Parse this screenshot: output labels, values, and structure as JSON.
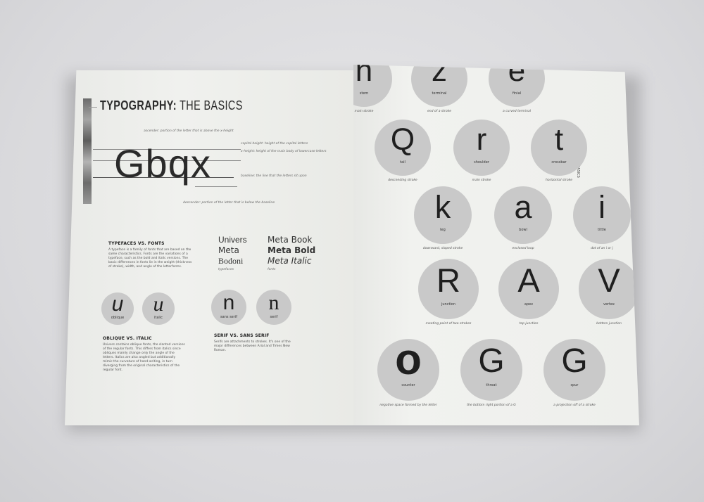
{
  "left_page": {
    "title_part1": "TYPOGRAPHY:",
    "title_part2": "THE BASICS",
    "specimen": "Gbqx",
    "notes": {
      "ascender": "ascender: portion of the letter that is above the x-height",
      "cap_height": "capital height: height of the capital letters",
      "x_height": "x-height: height of the main body of lowercase letters",
      "baseline": "baseline: the line that the letters sit upon",
      "descender": "descender: portion of the letter that is below the baseline"
    },
    "typefaces": {
      "heading": "TYPEFACES VS. FONTS",
      "body": "A typeface is a family of fonts that are based on the same characteristics. Fonts are the variations of a typeface, such as the bold and italic versions. The basic differences in fonts lie in the weight (thickness of stroke), width, and angle of the letterforms.",
      "typeface_list": [
        "Univers",
        "Meta",
        "Bodoni"
      ],
      "typefaces_caption": "typefaces",
      "font_list": [
        "Meta Book",
        "Meta Bold",
        "Meta Italic"
      ],
      "fonts_caption": "fonts"
    },
    "oblique": {
      "heading": "OBLIQUE VS. ITALIC",
      "body": "Univers contains oblique fonts, the slanted versions of the regular fonts. This differs from italics since obliques mainly change only the angle of the letters. Italics are also angled but additionally mimic the curvature of hand-writing, in turn diverging from the original characteristics of the regular font.",
      "circles": [
        {
          "glyph": "u",
          "label": "oblique"
        },
        {
          "glyph": "u",
          "label": "italic"
        }
      ]
    },
    "serif": {
      "heading": "SERIF VS. SANS SERIF",
      "body": "Serifs are attachments to strokes. It's one of the major differences between Arial and Times New Roman.",
      "circles": [
        {
          "glyph": "n",
          "label": "sans serif"
        },
        {
          "glyph": "n",
          "label": "serif"
        }
      ]
    }
  },
  "right_page": {
    "side_text": "TYPOGRAPHY: THE BASICS",
    "anatomy": [
      {
        "glyph": "n",
        "label": "stem",
        "caption": "main stroke"
      },
      {
        "glyph": "z",
        "label": "terminal",
        "caption": "end of a stroke"
      },
      {
        "glyph": "e",
        "label": "finial",
        "caption": "a curved terminal"
      },
      {
        "glyph": "Q",
        "label": "tail",
        "caption": "descending stroke"
      },
      {
        "glyph": "r",
        "label": "shoulder",
        "caption": "main stroke"
      },
      {
        "glyph": "t",
        "label": "crossbar",
        "caption": "horizontal stroke"
      },
      {
        "glyph": "k",
        "label": "leg",
        "caption": "downward, sloped stroke"
      },
      {
        "glyph": "a",
        "label": "bowl",
        "caption": "enclosed loop"
      },
      {
        "glyph": "i",
        "label": "tittle",
        "caption": "dot of an i or j"
      },
      {
        "glyph": "R",
        "label": "junction",
        "caption": "meeting point of two strokes"
      },
      {
        "glyph": "A",
        "label": "apex",
        "caption": "top junction"
      },
      {
        "glyph": "V",
        "label": "vertex",
        "caption": "bottom junction"
      },
      {
        "glyph": "o",
        "label": "counter",
        "caption": "negative space formed by the letter"
      },
      {
        "glyph": "G",
        "label": "throat",
        "caption": "the bottom right portion of a G"
      },
      {
        "glyph": "G",
        "label": "spur",
        "caption": "a projection off of a stroke"
      }
    ]
  }
}
